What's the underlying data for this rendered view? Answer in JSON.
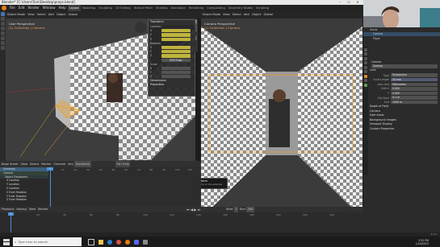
{
  "app": {
    "title": "Blender* [C:\\Users\\Tom\\Desktop\\props.blend]",
    "window_controls": [
      "–",
      "☐",
      "✕"
    ]
  },
  "menu": {
    "items": [
      "File",
      "Edit",
      "Render",
      "Window",
      "Help"
    ],
    "workspaces": [
      "Layout",
      "Modeling",
      "Sculpting",
      "UV Editing",
      "Texture Paint",
      "Shading",
      "Animation",
      "Rendering",
      "Compositing",
      "Geometry Nodes",
      "Scripting"
    ],
    "active_workspace": "Layout"
  },
  "viewport_left": {
    "header": [
      "Object Mode",
      "View",
      "Select",
      "Add",
      "Object",
      "Global"
    ],
    "label": "User Perspective",
    "sublabel": "(1) Collection | Camera"
  },
  "viewport_right": {
    "header": [
      "Object Mode",
      "View",
      "Select",
      "Add",
      "Object",
      "Global"
    ],
    "label": "Camera Perspective",
    "sublabel": "(1) Collection | Camera"
  },
  "npanel": {
    "transform_title": "Transform",
    "location_label": "Location",
    "rotation_label": "Rotation",
    "scale_label": "Scale",
    "axes": [
      "X",
      "Y",
      "Z"
    ],
    "mode_label": "XYZ Euler",
    "dimensions_label": "Dimensions",
    "properties_label": "Properties",
    "tabs": [
      "Item",
      "Tool",
      "View"
    ]
  },
  "tooltip": {
    "title": "Object Transform",
    "body": "Insert a keyframe on the selected element(s)."
  },
  "dopesheet": {
    "header": [
      "Dope Sheet",
      "View",
      "Select",
      "Marker",
      "Channel",
      "Key"
    ],
    "mode": "Summary",
    "keying": "Ctrl Only",
    "rows": [
      "Summary",
      "Camera",
      "Object Transforms",
      "X Location",
      "Y Location",
      "Z Location",
      "X Euler Rotation",
      "Y Euler Rotation",
      "Z Euler Rotation"
    ],
    "frame_labels": [
      "0",
      "10",
      "20",
      "30",
      "40",
      "50",
      "60",
      "70",
      "80",
      "90",
      "100",
      "110"
    ],
    "current_frame": "1"
  },
  "timeline": {
    "header": [
      "Playback",
      "Keying",
      "View",
      "Marker"
    ],
    "start_label": "Start",
    "start": "1",
    "end_label": "End",
    "end": "250",
    "current": "1",
    "frame_labels": [
      "0",
      "20",
      "40",
      "60",
      "80",
      "100",
      "120",
      "140",
      "160",
      "180",
      "200",
      "220",
      "240"
    ]
  },
  "outliner": {
    "items": [
      "Scene",
      "Camera",
      "Plane"
    ]
  },
  "properties": {
    "object_name": "Camera",
    "data_name": "Camera",
    "section_lens": "Lens",
    "type_label": "Type",
    "type_value": "Perspective",
    "focal_label": "Focal Length",
    "focal_value": "50 mm",
    "lens_unit_label": "Lens Unit",
    "lens_unit_value": "Millimeters",
    "shift_x_label": "Shift X",
    "shift_x_value": "0.000",
    "shift_y_label": "Y",
    "shift_y_value": "0.000",
    "clip_start_label": "Clip Start",
    "clip_start_value": "0.1 m",
    "clip_end_label": "End",
    "clip_end_value": "1000 m",
    "sections": [
      "Depth of Field",
      "Camera",
      "Safe Areas",
      "Background Images",
      "Viewport Display",
      "Custom Properties"
    ]
  },
  "status": {
    "version": "3.0.0"
  },
  "taskbar": {
    "search_placeholder": "Type here to search",
    "time": "3:32 PM",
    "date": "1/24/2022"
  }
}
